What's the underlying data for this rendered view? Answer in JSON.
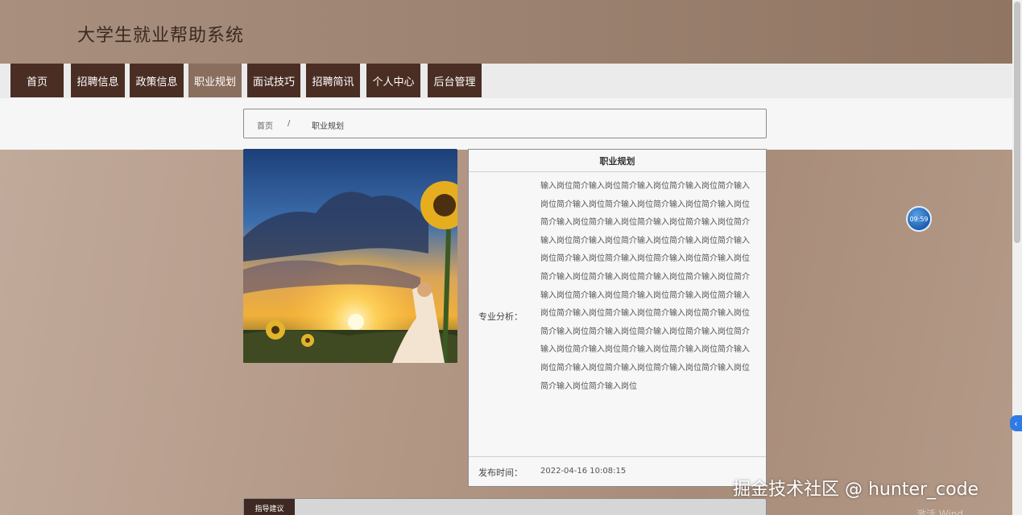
{
  "site": {
    "title": "大学生就业帮助系统"
  },
  "nav": {
    "items": [
      {
        "label": "首页"
      },
      {
        "label": "招聘信息"
      },
      {
        "label": "政策信息"
      },
      {
        "label": "职业规划"
      },
      {
        "label": "面试技巧"
      },
      {
        "label": "招聘简讯"
      },
      {
        "label": "个人中心"
      },
      {
        "label": "后台管理"
      }
    ],
    "active_index": 3
  },
  "breadcrumb": {
    "home": "首页",
    "separator": "/",
    "current": "职业规划"
  },
  "detail": {
    "title": "职业规划",
    "analysis_label": "专业分析：",
    "analysis_text": "输入岗位简介输入岗位简介输入岗位简介输入岗位简介输入岗位简介输入岗位简介输入岗位简介输入岗位简介输入岗位简介输入岗位简介输入岗位简介输入岗位简介输入岗位简介输入岗位简介输入岗位简介输入岗位简介输入岗位简介输入岗位简介输入岗位简介输入岗位简介输入岗位简介输入岗位简介输入岗位简介输入岗位简介输入岗位简介输入岗位简介输入岗位简介输入岗位简介输入岗位简介输入岗位简介输入岗位简介输入岗位简介输入岗位简介输入岗位简介输入岗位简介输入岗位简介输入岗位简介输入岗位简介输入岗位简介输入岗位简介输入岗位简介输入岗位简介输入岗位简介输入岗位简介输入岗位简介输入岗位简介输入岗位简介输入岗位简介输入岗位简介输入岗位",
    "time_label": "发布时间：",
    "time_value": "2022-04-16 10:08:15"
  },
  "bottom_tab": {
    "label": "指导建议"
  },
  "clock": {
    "time": "09:59"
  },
  "watermark": {
    "text": "掘金技术社区 @ hunter_code"
  },
  "os_overlay": {
    "text": "激活 Wind"
  }
}
